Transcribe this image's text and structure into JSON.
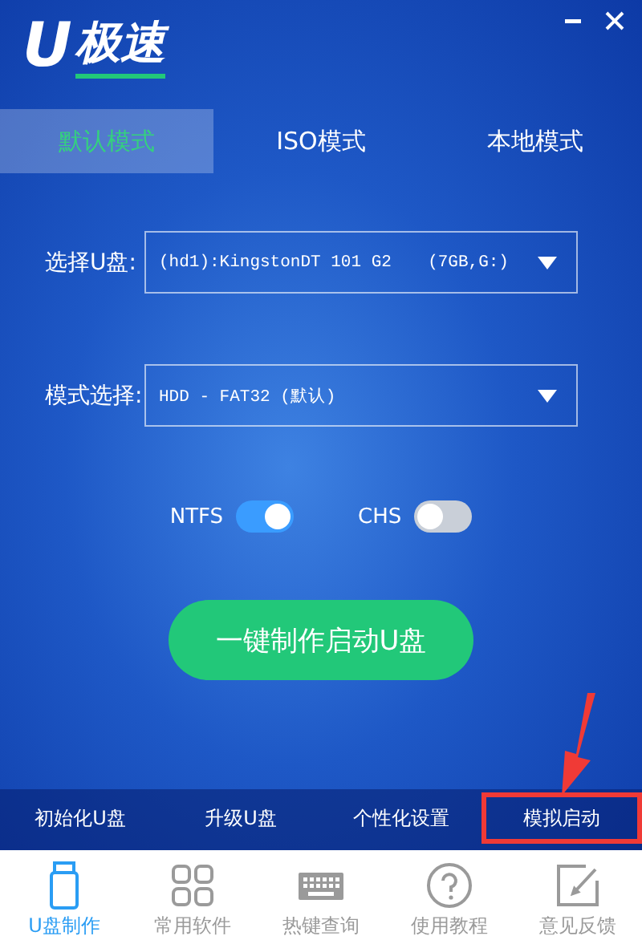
{
  "logo": {
    "mark": "U",
    "text": "极速"
  },
  "tabs": [
    {
      "label": "默认模式",
      "selected": true
    },
    {
      "label": "ISO模式",
      "selected": false
    },
    {
      "label": "本地模式",
      "selected": false
    }
  ],
  "fields": [
    {
      "label": "选择U盘:",
      "value": "(hd1):KingstonDT 101 G2",
      "detail": "(7GB,G:)"
    },
    {
      "label": "模式选择:",
      "value": "HDD - FAT32 (默认)"
    }
  ],
  "toggles": [
    {
      "label": "NTFS",
      "on": true
    },
    {
      "label": "CHS",
      "on": false
    }
  ],
  "primary_button": "一键制作启动U盘",
  "tools": [
    {
      "label": "初始化U盘",
      "highlighted": false
    },
    {
      "label": "升级U盘",
      "highlighted": false
    },
    {
      "label": "个性化设置",
      "highlighted": false
    },
    {
      "label": "模拟启动",
      "highlighted": true
    }
  ],
  "nav": [
    {
      "label": "U盘制作",
      "kind": "usb",
      "selected": true
    },
    {
      "label": "常用软件",
      "kind": "apps",
      "selected": false
    },
    {
      "label": "热键查询",
      "kind": "keyboard",
      "selected": false
    },
    {
      "label": "使用教程",
      "kind": "help",
      "selected": false
    },
    {
      "label": "意见反馈",
      "kind": "edit",
      "selected": false
    }
  ]
}
